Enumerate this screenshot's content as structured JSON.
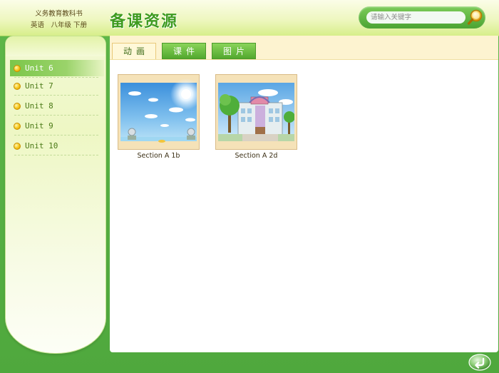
{
  "header": {
    "book_line1": "义务教育教科书",
    "book_line2": "英语　八年级 下册",
    "title": "备课资源"
  },
  "search": {
    "placeholder": "请输入关键字",
    "value": ""
  },
  "sidebar": {
    "items": [
      {
        "label": "Unit 6",
        "active": true
      },
      {
        "label": "Unit 7",
        "active": false
      },
      {
        "label": "Unit 8",
        "active": false
      },
      {
        "label": "Unit 9",
        "active": false
      },
      {
        "label": "Unit 10",
        "active": false
      }
    ]
  },
  "tabs": [
    {
      "label": "动画",
      "active": true
    },
    {
      "label": "课件",
      "active": false
    },
    {
      "label": "图片",
      "active": false
    }
  ],
  "resources": [
    {
      "label": "Section A 1b"
    },
    {
      "label": "Section A 2d"
    }
  ],
  "colors": {
    "frame": "#5fb84a",
    "title": "#3e9b1f",
    "sidebar_active": "#7cc64a",
    "tab_active_bg": "#fff8d8",
    "tab_inactive_bg": "#52a82e"
  },
  "icons": {
    "search": "magnifier-icon",
    "back": "return-arrow-icon",
    "list_bullet": "yellow-dot-icon"
  }
}
